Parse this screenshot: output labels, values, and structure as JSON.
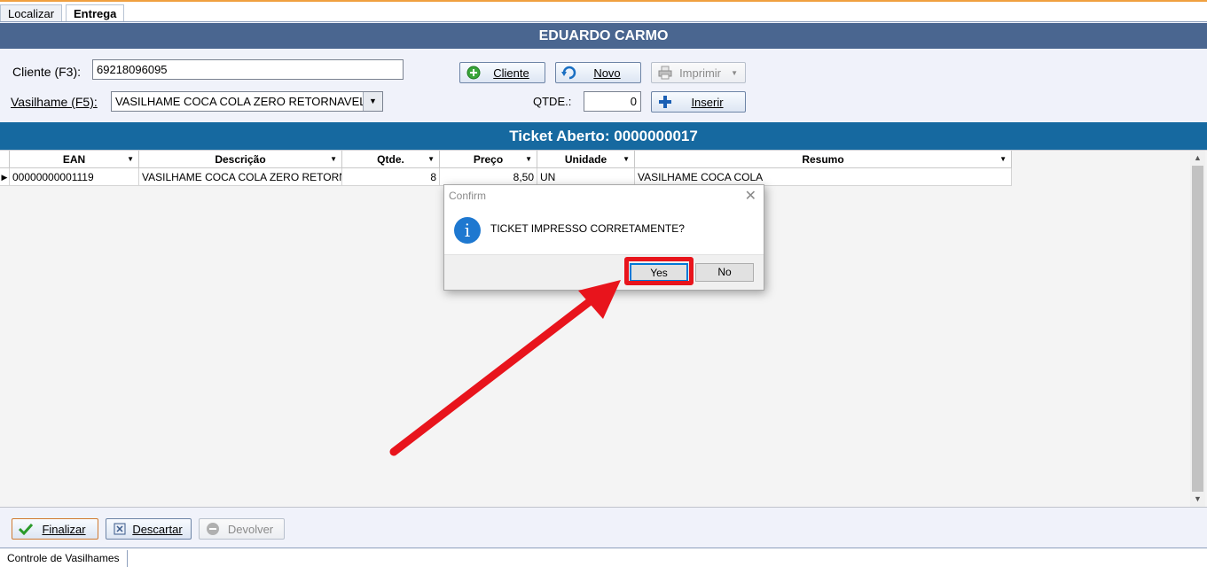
{
  "tabs": {
    "localizar": "Localizar",
    "entrega": "Entrega"
  },
  "header": {
    "title": "EDUARDO CARMO"
  },
  "form": {
    "cliente_label_pre": "Cliente (F3):",
    "cliente_value": "69218096095",
    "vasilhame_label": "Vasilhame (F5):",
    "vasilhame_value": "VASILHAME COCA COLA ZERO RETORNAVEL",
    "qtde_label": "QTDE.:",
    "qtde_value": "0"
  },
  "buttons": {
    "cliente": "Cliente",
    "novo": "Novo",
    "imprimir": "Imprimir",
    "inserir": "Inserir",
    "finalizar": "Finalizar",
    "descartar": "Descartar",
    "devolver": "Devolver"
  },
  "ticket": {
    "title": "Ticket Aberto: 0000000017"
  },
  "grid": {
    "columns": [
      "EAN",
      "Descrição",
      "Qtde.",
      "Preço",
      "Unidade",
      "Resumo"
    ],
    "rows": [
      {
        "ean": "00000000001119",
        "descricao": "VASILHAME COCA COLA ZERO RETORNAVEL",
        "qtde": "8",
        "preco": "8,50",
        "unidade": "UN",
        "resumo": "VASILHAME COCA COLA"
      }
    ]
  },
  "dialog": {
    "title": "Confirm",
    "message": "TICKET IMPRESSO CORRETAMENTE?",
    "yes": "Yes",
    "no": "No"
  },
  "statusbar": {
    "tab": "Controle de Vasilhames"
  },
  "colors": {
    "header": "#4a6690",
    "ticket_band": "#1669a0",
    "highlight": "#e8141c",
    "info_icon": "#1e78d0"
  }
}
